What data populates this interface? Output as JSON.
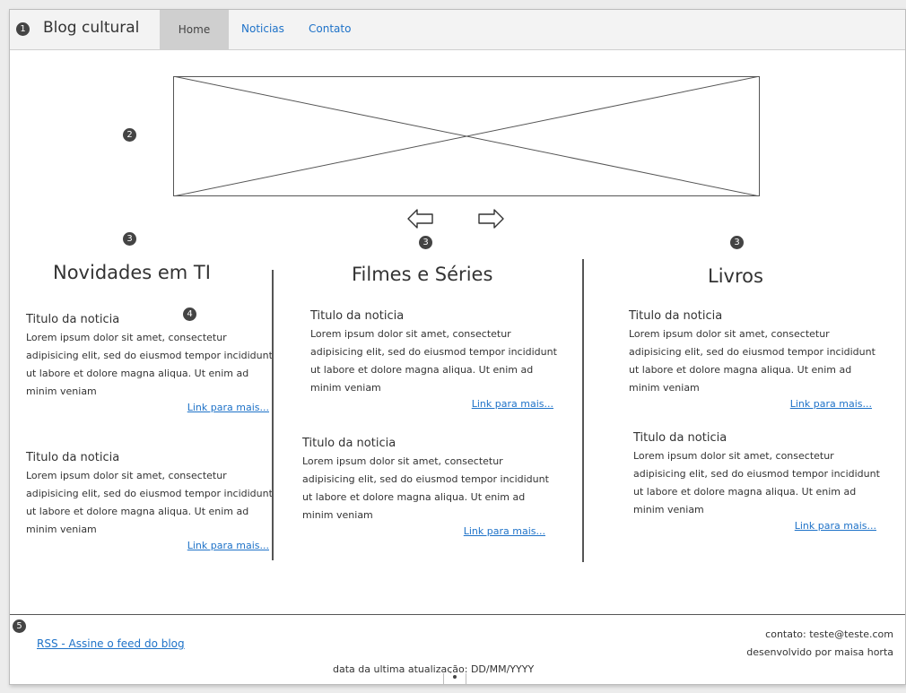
{
  "header": {
    "brand": "Blog cultural",
    "nav": {
      "home": "Home",
      "noticias": "Noticias",
      "contato": "Contato"
    }
  },
  "annotations": {
    "a1": "1",
    "a2": "2",
    "a3": "3",
    "a4": "4",
    "a5": "5"
  },
  "carousel": {
    "prev_icon": "left-arrow-icon",
    "next_icon": "right-arrow-icon"
  },
  "columns": [
    {
      "title": "Novidades em TI",
      "items": [
        {
          "title": "Titulo da noticia",
          "body": "Lorem ipsum dolor sit amet, consectetur adipisicing elit, sed do eiusmod tempor incididunt ut labore et dolore magna aliqua. Ut enim ad minim veniam",
          "link": "Link para mais..."
        },
        {
          "title": "Titulo da noticia",
          "body": "Lorem ipsum dolor sit amet, consectetur adipisicing elit, sed do eiusmod tempor incididunt ut labore et dolore magna aliqua. Ut enim ad minim veniam",
          "link": "Link para mais..."
        }
      ]
    },
    {
      "title": "Filmes e Séries",
      "items": [
        {
          "title": "Titulo da noticia",
          "body": "Lorem ipsum dolor sit amet, consectetur adipisicing elit, sed do eiusmod tempor incididunt ut labore et dolore magna aliqua. Ut enim ad minim veniam",
          "link": "Link para mais..."
        },
        {
          "title": "Titulo da noticia",
          "body": "Lorem ipsum dolor sit amet, consectetur adipisicing elit, sed do eiusmod tempor incididunt ut labore et dolore magna aliqua. Ut enim ad minim veniam",
          "link": "Link para mais..."
        }
      ]
    },
    {
      "title": "Livros",
      "items": [
        {
          "title": "Titulo da noticia",
          "body": "Lorem ipsum dolor sit amet, consectetur adipisicing elit, sed do eiusmod tempor incididunt ut labore et dolore magna aliqua. Ut enim ad minim veniam",
          "link": "Link para mais..."
        },
        {
          "title": "Titulo da noticia",
          "body": "Lorem ipsum dolor sit amet, consectetur adipisicing elit, sed do eiusmod tempor incididunt ut labore et dolore magna aliqua. Ut enim ad minim veniam",
          "link": "Link para mais..."
        }
      ]
    }
  ],
  "footer": {
    "rss": "RSS - Assine o feed do blog",
    "contact": "contato: teste@teste.com",
    "developer": "desenvolvido por maisa horta",
    "updated": "data da ultima atualização: DD/MM/YYYY"
  },
  "colors": {
    "link": "#1e72c8",
    "nav_active_bg": "#cfcfcf",
    "topbar_bg": "#f3f3f3"
  }
}
